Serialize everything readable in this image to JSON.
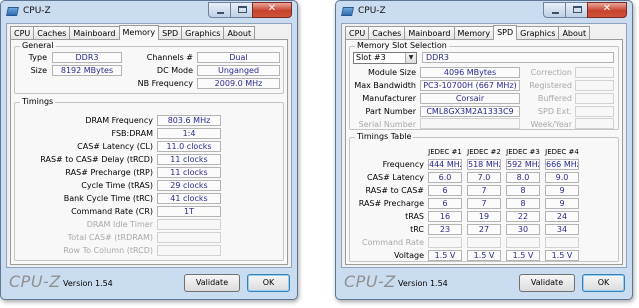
{
  "memory_window": {
    "title": "CPU-Z",
    "tabs": [
      "CPU",
      "Caches",
      "Mainboard",
      "Memory",
      "SPD",
      "Graphics",
      "About"
    ],
    "active_tab": "Memory",
    "general": {
      "legend": "General",
      "type_label": "Type",
      "type_value": "DDR3",
      "size_label": "Size",
      "size_value": "8192 MBytes",
      "channels_label": "Channels #",
      "channels_value": "Dual",
      "dcmode_label": "DC Mode",
      "dcmode_value": "Unganged",
      "nbfreq_label": "NB Frequency",
      "nbfreq_value": "2009.0 MHz"
    },
    "timings": {
      "legend": "Timings",
      "rows": [
        {
          "label": "DRAM Frequency",
          "value": "803.6 MHz"
        },
        {
          "label": "FSB:DRAM",
          "value": "1:4"
        },
        {
          "label": "CAS# Latency (CL)",
          "value": "11.0 clocks"
        },
        {
          "label": "RAS# to CAS# Delay (tRCD)",
          "value": "11 clocks"
        },
        {
          "label": "RAS# Precharge (tRP)",
          "value": "11 clocks"
        },
        {
          "label": "Cycle Time (tRAS)",
          "value": "29 clocks"
        },
        {
          "label": "Bank Cycle Time (tRC)",
          "value": "41 clocks"
        },
        {
          "label": "Command Rate (CR)",
          "value": "1T"
        },
        {
          "label": "DRAM Idle Timer",
          "value": ""
        },
        {
          "label": "Total CAS# (tRDRAM)",
          "value": ""
        },
        {
          "label": "Row To Column (tRCD)",
          "value": ""
        }
      ]
    },
    "footer": {
      "brand": "CPU-Z",
      "version": "Version 1.54",
      "validate": "Validate",
      "ok": "OK"
    }
  },
  "spd_window": {
    "title": "CPU-Z",
    "tabs": [
      "CPU",
      "Caches",
      "Mainboard",
      "Memory",
      "SPD",
      "Graphics",
      "About"
    ],
    "active_tab": "SPD",
    "slot_section": {
      "legend": "Memory Slot Selection",
      "slot_selected": "Slot #3",
      "memory_type": "DDR3",
      "module_size_label": "Module Size",
      "module_size_value": "4096 MBytes",
      "max_bw_label": "Max Bandwidth",
      "max_bw_value": "PC3-10700H (667 MHz)",
      "manufacturer_label": "Manufacturer",
      "manufacturer_value": "Corsair",
      "part_label": "Part Number",
      "part_value": "CML8GX3M2A1333C9",
      "serial_label": "Serial Number",
      "serial_value": "",
      "correction_label": "Correction",
      "registered_label": "Registered",
      "buffered_label": "Buffered",
      "spdext_label": "SPD Ext.",
      "weekyear_label": "Week/Year"
    },
    "timings_table": {
      "legend": "Timings Table",
      "columns": [
        "JEDEC #1",
        "JEDEC #2",
        "JEDEC #3",
        "JEDEC #4"
      ],
      "rows": [
        {
          "label": "Frequency",
          "values": [
            "444 MHz",
            "518 MHz",
            "592 MHz",
            "666 MHz"
          ]
        },
        {
          "label": "CAS# Latency",
          "values": [
            "6.0",
            "7.0",
            "8.0",
            "9.0"
          ]
        },
        {
          "label": "RAS# to CAS#",
          "values": [
            "6",
            "7",
            "8",
            "9"
          ]
        },
        {
          "label": "RAS# Precharge",
          "values": [
            "6",
            "7",
            "8",
            "9"
          ]
        },
        {
          "label": "tRAS",
          "values": [
            "16",
            "19",
            "22",
            "24"
          ]
        },
        {
          "label": "tRC",
          "values": [
            "23",
            "27",
            "30",
            "34"
          ]
        },
        {
          "label": "Command Rate",
          "values": [
            "",
            "",
            "",
            ""
          ]
        },
        {
          "label": "Voltage",
          "values": [
            "1.5 V",
            "1.5 V",
            "1.5 V",
            "1.5 V"
          ]
        }
      ]
    },
    "footer": {
      "brand": "CPU-Z",
      "version": "Version 1.54",
      "validate": "Validate",
      "ok": "OK"
    }
  }
}
